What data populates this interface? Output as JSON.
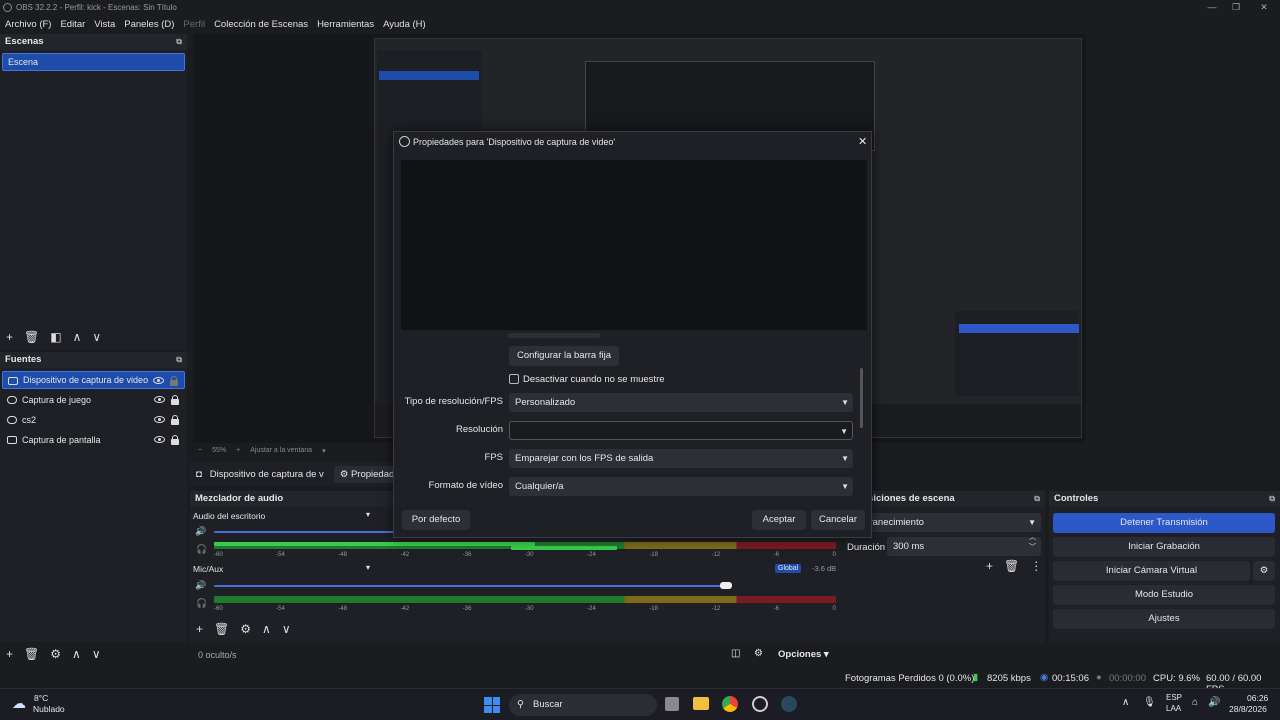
{
  "window": {
    "title": "OBS 32.2.2 - Perfil: kick - Escenas: Sin Título"
  },
  "menu": [
    "Archivo (F)",
    "Editar",
    "Vista",
    "Paneles (D)",
    "Perfil",
    "Colección de Escenas",
    "Herramientas",
    "Ayuda (H)"
  ],
  "scenes": {
    "title": "Escenas",
    "items": [
      "Escena"
    ]
  },
  "sources": {
    "title": "Fuentes",
    "items": [
      "Dispositivo de captura de video",
      "Captura de juego",
      "cs2",
      "Captura de pantalla"
    ]
  },
  "preview": {
    "zoom": "55%",
    "fit": "Ajustar a la ventana"
  },
  "context": {
    "source": "Dispositivo de captura de v",
    "properties": "Propiedad"
  },
  "audio": {
    "title": "Mezclador de audio",
    "channels": [
      {
        "name": "Audio del escritorio",
        "level": 0.81
      },
      {
        "name": "Mic/Aux",
        "badge": "Global",
        "db": "-3.6 dB",
        "level": 0.81
      }
    ],
    "ticks": [
      "-60",
      "-54",
      "-48",
      "-42",
      "-36",
      "-30",
      "-24",
      "-18",
      "-12",
      "-6",
      "0"
    ],
    "hidden": "0 oculto/s",
    "options": "Opciones"
  },
  "transitions": {
    "title": "Transiciones de escena",
    "type": "Desvanecimiento",
    "duration_label": "Duración",
    "duration": "300 ms"
  },
  "controls": {
    "title": "Controles",
    "buttons": [
      "Detener Transmisión",
      "Iniciar Grabación",
      "Iniciar Cámara Virtual",
      "Modo Estudio",
      "Ajustes"
    ]
  },
  "status": {
    "dropped": "Fotogramas Perdidos 0 (0.0%)",
    "kbps": "8205 kbps",
    "stream_time": "00:15:06",
    "rec_time": "00:00:00",
    "cpu": "CPU: 9.6%",
    "fps": "60.00 / 60.00 FPS"
  },
  "dialog": {
    "title": "Propiedades para 'Dispositivo de captura de video'",
    "configure": "Configurar la barra fija",
    "deactivate": "Desactivar cuando no se muestre",
    "fields": [
      {
        "label": "Tipo de resolución/FPS",
        "value": "Personalizado"
      },
      {
        "label": "Resolución",
        "value": ""
      },
      {
        "label": "FPS",
        "value": "Emparejar con los FPS de salida"
      },
      {
        "label": "Formato de vídeo",
        "value": "Cualquier/a"
      }
    ],
    "defaults": "Por defecto",
    "accept": "Aceptar",
    "cancel": "Cancelar"
  },
  "taskbar": {
    "temp": "8°C",
    "weather": "Nublado",
    "search": "Buscar",
    "lang1": "ESP",
    "lang2": "LAA",
    "time": "06:26",
    "date": "28/8/2026"
  }
}
